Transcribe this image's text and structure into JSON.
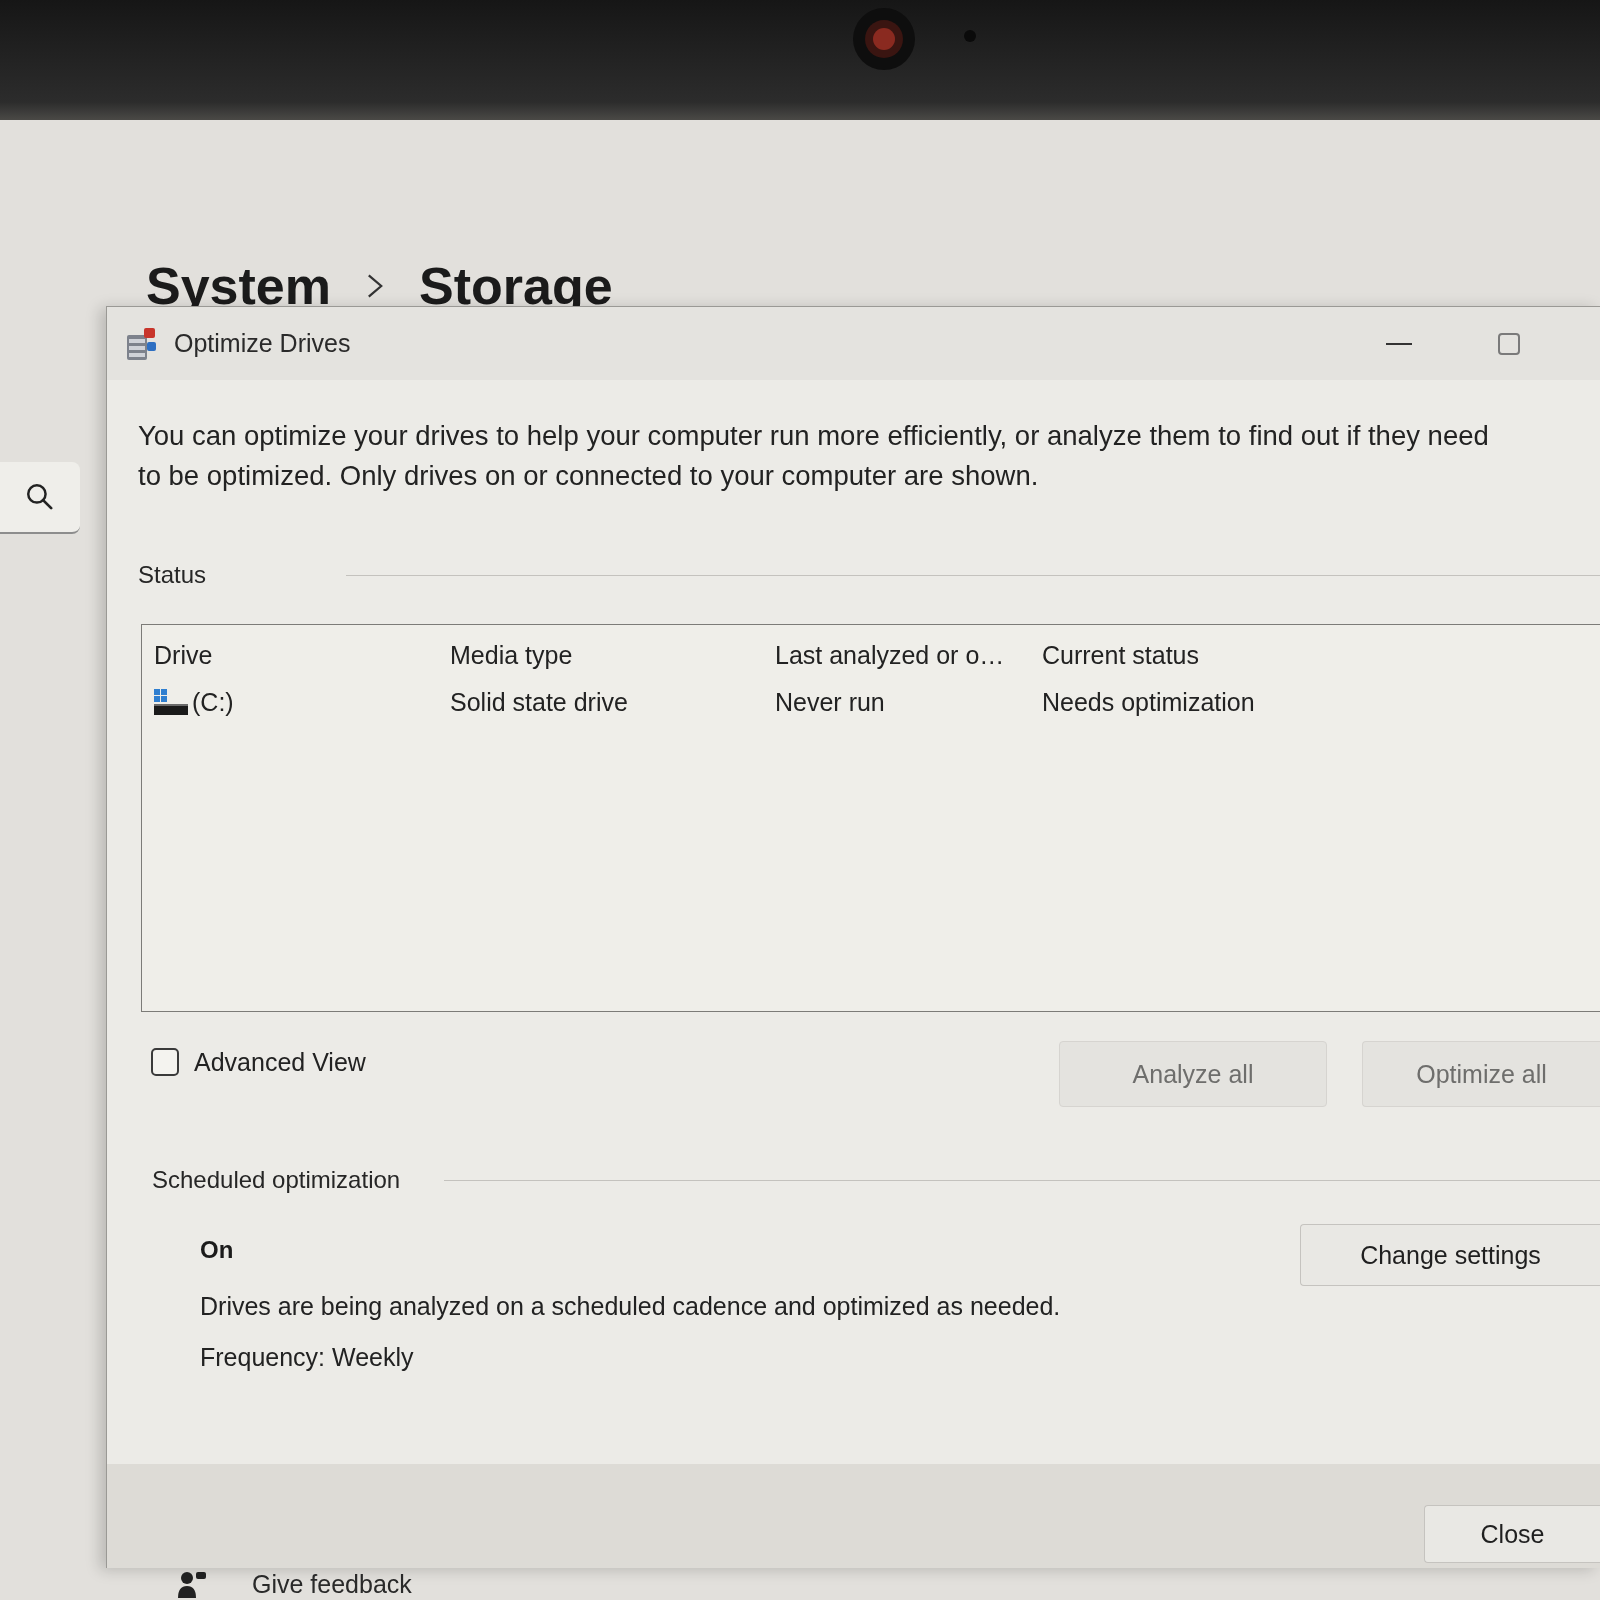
{
  "background_page": {
    "breadcrumb": [
      "System",
      "Storage"
    ],
    "feedback_link": "Give feedback"
  },
  "dialog": {
    "title": "Optimize Drives",
    "description": "You can optimize your drives to help your computer run more efficiently, or analyze them to find out if they need to be optimized. Only drives on or connected to your computer are shown.",
    "status": {
      "label": "Status",
      "table": {
        "columns": [
          "Drive",
          "Media type",
          "Last analyzed or o…",
          "Current status"
        ],
        "rows": [
          {
            "cells": [
              "(C:)",
              "Solid state drive",
              "Never run",
              "Needs optimization"
            ]
          }
        ]
      }
    },
    "advanced_view": {
      "label": "Advanced View",
      "checked": false
    },
    "actions": [
      {
        "label": "Analyze all",
        "disabled": true
      },
      {
        "label": "Optimize all",
        "disabled": true
      }
    ],
    "scheduled_optimization": {
      "label": "Scheduled optimization",
      "state": "On",
      "description": "Drives are being analyzed on a scheduled cadence and optimized as needed.",
      "frequency": "Frequency: Weekly",
      "button": {
        "label": "Change settings",
        "disabled": false
      }
    },
    "close_button": {
      "label": "Close",
      "disabled": false
    }
  }
}
